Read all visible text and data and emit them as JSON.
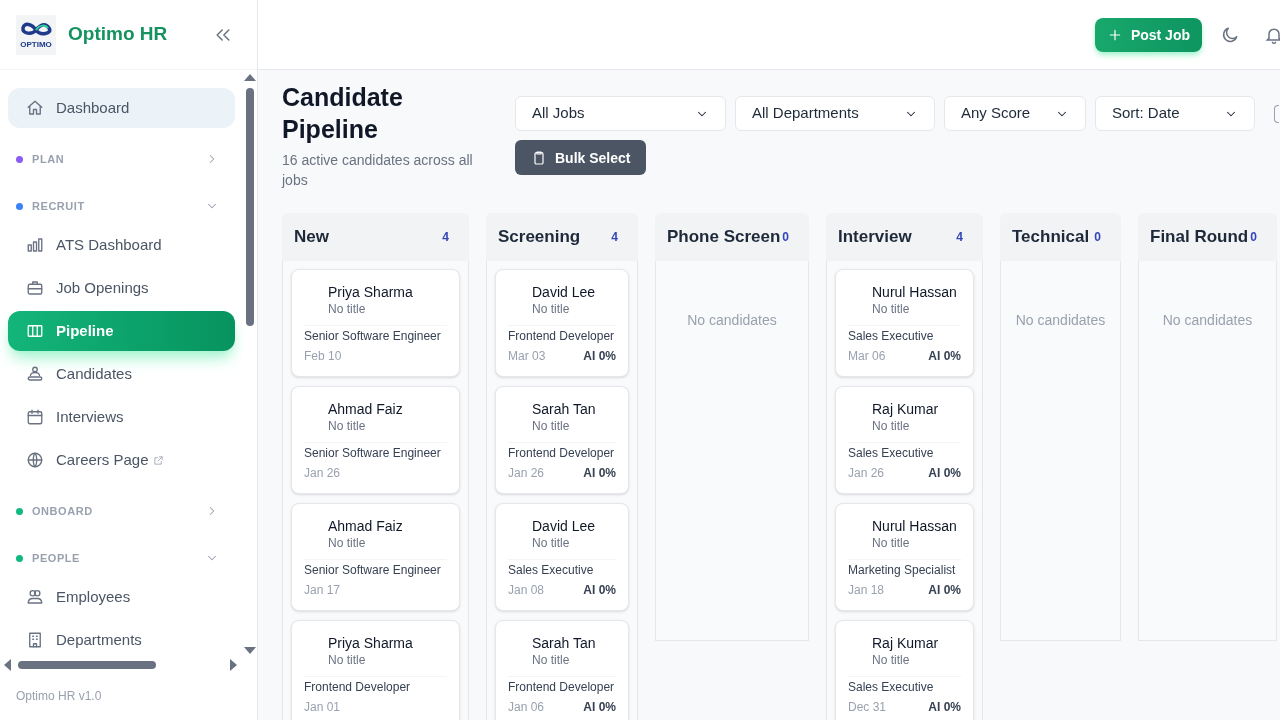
{
  "brand": {
    "logo_text": "OPTIMO",
    "name": "Optimo HR"
  },
  "sidebar": {
    "items": [
      {
        "kind": "link",
        "label": "Dashboard",
        "selected": false,
        "hovered": true,
        "external": false
      },
      {
        "kind": "section",
        "label": "PLAN",
        "color": "#8b5cf6",
        "expanded": false
      },
      {
        "kind": "section",
        "label": "RECRUIT",
        "color": "#3b82f6",
        "expanded": true,
        "children": [
          {
            "kind": "link",
            "label": "ATS Dashboard",
            "selected": false,
            "hovered": false,
            "external": false
          },
          {
            "kind": "link",
            "label": "Job Openings",
            "selected": false,
            "hovered": false,
            "external": false
          },
          {
            "kind": "link",
            "label": "Pipeline",
            "selected": true,
            "hovered": false,
            "external": false
          },
          {
            "kind": "link",
            "label": "Candidates",
            "selected": false,
            "hovered": false,
            "external": false
          },
          {
            "kind": "link",
            "label": "Interviews",
            "selected": false,
            "hovered": false,
            "external": false
          },
          {
            "kind": "link",
            "label": "Careers Page",
            "selected": false,
            "hovered": false,
            "external": true
          }
        ]
      },
      {
        "kind": "section",
        "label": "ONBOARD",
        "color": "#10b981",
        "expanded": false
      },
      {
        "kind": "section",
        "label": "PEOPLE",
        "color": "#10b981",
        "expanded": true,
        "children": [
          {
            "kind": "link",
            "label": "Employees",
            "selected": false,
            "hovered": false,
            "external": false
          },
          {
            "kind": "link",
            "label": "Departments",
            "selected": false,
            "hovered": false,
            "external": false
          }
        ]
      }
    ],
    "version": "Optimo HR v1.0"
  },
  "header": {
    "post_button": "Post Job"
  },
  "page": {
    "title": "Candidate Pipeline",
    "subtitle": "16 active candidates across all jobs",
    "filters": [
      "All Jobs",
      "All Departments",
      "Any Score",
      "Sort: Date"
    ],
    "bulk_button": "Bulk Select"
  },
  "columns": [
    {
      "name": "New",
      "count": "4",
      "cards": [
        {
          "name": "Priya Sharma",
          "title": "No title",
          "job": "Senior Software Engineer",
          "date": "Feb 10"
        },
        {
          "name": "Ahmad Faiz",
          "title": "No title",
          "job": "Senior Software Engineer",
          "date": "Jan 26"
        },
        {
          "name": "Ahmad Faiz",
          "title": "No title",
          "job": "Senior Software Engineer",
          "date": "Jan 17"
        },
        {
          "name": "Priya Sharma",
          "title": "No title",
          "job": "Frontend Developer",
          "date": "Jan 01"
        }
      ]
    },
    {
      "name": "Screening",
      "count": "4",
      "cards": [
        {
          "name": "David Lee",
          "title": "No title",
          "job": "Frontend Developer",
          "date": "Mar 03",
          "ai_score": "AI 0%"
        },
        {
          "name": "Sarah Tan",
          "title": "No title",
          "job": "Frontend Developer",
          "date": "Jan 26",
          "ai_score": "AI 0%"
        },
        {
          "name": "David Lee",
          "title": "No title",
          "job": "Sales Executive",
          "date": "Jan 08",
          "ai_score": "AI 0%"
        },
        {
          "name": "Sarah Tan",
          "title": "No title",
          "job": "Frontend Developer",
          "date": "Jan 06",
          "ai_score": "AI 0%"
        }
      ]
    },
    {
      "name": "Phone Screen",
      "count": "0",
      "empty_text": "No candidates"
    },
    {
      "name": "Interview",
      "count": "4",
      "cards": [
        {
          "name": "Nurul Hassan",
          "title": "No title",
          "job": "Sales Executive",
          "date": "Mar 06",
          "ai_score": "AI 0%"
        },
        {
          "name": "Raj Kumar",
          "title": "No title",
          "job": "Sales Executive",
          "date": "Jan 26",
          "ai_score": "AI 0%"
        },
        {
          "name": "Nurul Hassan",
          "title": "No title",
          "job": "Marketing Specialist",
          "date": "Jan 18",
          "ai_score": "AI 0%"
        },
        {
          "name": "Raj Kumar",
          "title": "No title",
          "job": "Sales Executive",
          "date": "Dec 31",
          "ai_score": "AI 0%"
        }
      ]
    },
    {
      "name": "Technical",
      "count": "0",
      "empty_text": "No candidates"
    },
    {
      "name": "Final Round",
      "count": "0",
      "empty_text": "No candidates"
    }
  ]
}
